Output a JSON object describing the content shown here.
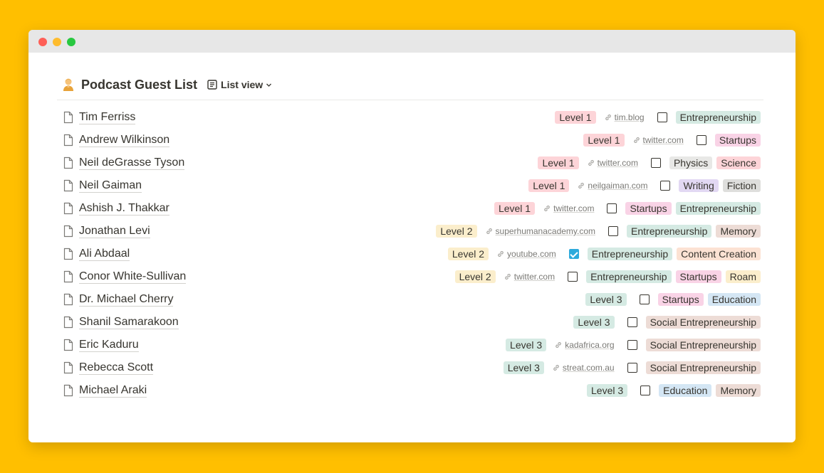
{
  "window": {
    "title": ""
  },
  "header": {
    "title": "Podcast Guest List",
    "icon": "person-emoji-icon",
    "view": {
      "label": "List view",
      "icon": "list-view-icon"
    }
  },
  "colors": {
    "background": "#FFBF00",
    "level1": "#FDD4D8",
    "level2": "#FBEECC",
    "level3": "#D5EAE3",
    "check": "#2EAADC"
  },
  "rows": [
    {
      "name": "Tim Ferriss",
      "level": "Level 1",
      "url": "tim.blog",
      "checked": false,
      "tags": [
        "Entrepreneurship"
      ]
    },
    {
      "name": "Andrew Wilkinson",
      "level": "Level 1",
      "url": "twitter.com",
      "checked": false,
      "tags": [
        "Startups"
      ]
    },
    {
      "name": "Neil deGrasse Tyson",
      "level": "Level 1",
      "url": "twitter.com",
      "checked": false,
      "tags": [
        "Physics",
        "Science"
      ]
    },
    {
      "name": "Neil Gaiman",
      "level": "Level 1",
      "url": "neilgaiman.com",
      "checked": false,
      "tags": [
        "Writing",
        "Fiction"
      ]
    },
    {
      "name": "Ashish J. Thakkar",
      "level": "Level 1",
      "url": "twitter.com",
      "checked": false,
      "tags": [
        "Startups",
        "Entrepreneurship"
      ]
    },
    {
      "name": "Jonathan Levi",
      "level": "Level 2",
      "url": "superhumanacademy.com",
      "checked": false,
      "tags": [
        "Entrepreneurship",
        "Memory"
      ]
    },
    {
      "name": "Ali Abdaal",
      "level": "Level 2",
      "url": "youtube.com",
      "checked": true,
      "tags": [
        "Entrepreneurship",
        "Content Creation"
      ]
    },
    {
      "name": "Conor White-Sullivan",
      "level": "Level 2",
      "url": "twitter.com",
      "checked": false,
      "tags": [
        "Entrepreneurship",
        "Startups",
        "Roam"
      ]
    },
    {
      "name": "Dr. Michael Cherry",
      "level": "Level 3",
      "url": "",
      "checked": false,
      "tags": [
        "Startups",
        "Education"
      ]
    },
    {
      "name": "Shanil Samarakoon",
      "level": "Level 3",
      "url": "",
      "checked": false,
      "tags": [
        "Social Entrepreneurship"
      ]
    },
    {
      "name": "Eric Kaduru",
      "level": "Level 3",
      "url": "kadafrica.org",
      "checked": false,
      "tags": [
        "Social Entrepreneurship"
      ]
    },
    {
      "name": "Rebecca Scott",
      "level": "Level 3",
      "url": "streat.com.au",
      "checked": false,
      "tags": [
        "Social Entrepreneurship"
      ]
    },
    {
      "name": "Michael Araki",
      "level": "Level 3",
      "url": "",
      "checked": false,
      "tags": [
        "Education",
        "Memory"
      ]
    }
  ],
  "tag_colors": {
    "Entrepreneurship": "#D5EAE3",
    "Startups": "#F9D3E6",
    "Physics": "#E8E8E6",
    "Science": "#FDD4D8",
    "Writing": "#E2D8F3",
    "Fiction": "#DEDEDC",
    "Memory": "#EDDCD6",
    "Content Creation": "#FCE2D3",
    "Roam": "#FBEECC",
    "Education": "#D4E6F4",
    "Social Entrepreneurship": "#EDDCD6"
  }
}
